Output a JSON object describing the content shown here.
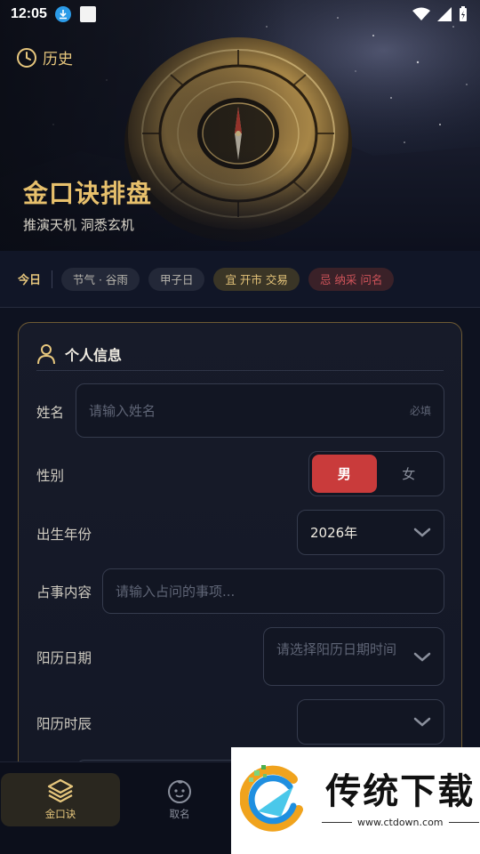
{
  "status_bar": {
    "time": "12:05"
  },
  "hero": {
    "history_label": "历史",
    "title": "金口诀排盘",
    "subtitle": "推演天机 洞悉玄机"
  },
  "almanac": {
    "today_label": "今日",
    "solar_term": "节气 · 谷雨",
    "day": "甲子日",
    "yi": "宜 开市 交易",
    "ji": "忌 纳采 问名"
  },
  "form": {
    "title": "个人信息",
    "name": {
      "label": "姓名",
      "placeholder": "请输入姓名",
      "required": "必填"
    },
    "gender": {
      "label": "性别",
      "male": "男",
      "female": "女",
      "selected": "男"
    },
    "birth_year": {
      "label": "出生年份",
      "value": "2026年"
    },
    "matter": {
      "label": "占事内容",
      "placeholder": "请输入占问的事项..."
    },
    "solar_date": {
      "label": "阳历日期",
      "placeholder": "请选择阳历日期时间"
    },
    "solar_hour": {
      "label": "阳历时辰",
      "value": ""
    }
  },
  "bottom_nav": {
    "items": [
      {
        "label": "金口诀",
        "icon": "layers-icon",
        "active": true
      },
      {
        "label": "取名",
        "icon": "baby-face-icon",
        "active": false
      }
    ]
  },
  "watermark": {
    "title": "传统下载",
    "url": "www.ctdown.com"
  },
  "colors": {
    "gold": "#e7c06c",
    "red": "#c93b3b",
    "background": "#0e1220"
  }
}
